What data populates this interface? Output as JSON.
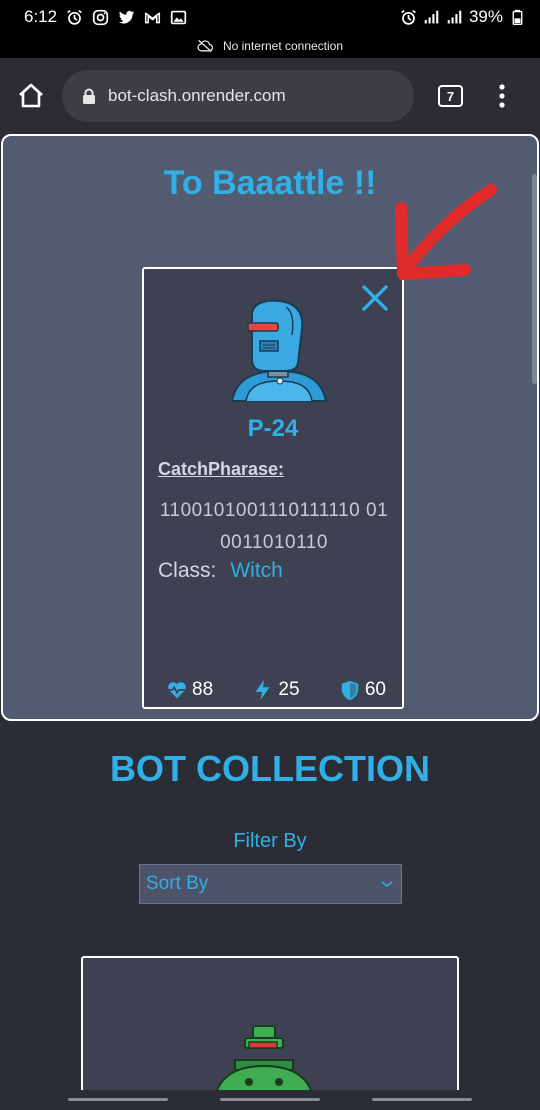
{
  "status_bar": {
    "time": "6:12",
    "battery": "39%",
    "left_icons": [
      "alarm-icon",
      "instagram-icon",
      "twitter-icon",
      "gmail-icon",
      "gallery-icon"
    ],
    "right_icons": [
      "alarm-icon",
      "signal-icon",
      "signal-icon",
      "battery-icon"
    ]
  },
  "offline_banner": "No internet connection",
  "browser": {
    "url": "bot-clash.onrender.com",
    "tab_count": "7"
  },
  "battle": {
    "title": "To Baaattle !!",
    "card": {
      "name": "P-24",
      "catchphrase_label": "CatchPharase:",
      "catchphrase_value": "1100101001110111110 010011010110",
      "class_label": "Class:",
      "class_value": "Witch",
      "health": "88",
      "damage": "25",
      "armor": "60"
    }
  },
  "collection": {
    "title": "BOT COLLECTION",
    "filter_label": "Filter By",
    "sort_placeholder": "Sort By"
  },
  "colors": {
    "accent": "#30b0e6",
    "panel": "#535b70",
    "card": "#3d4152",
    "background": "#2a2d36",
    "annotation_arrow": "#e12b2b"
  }
}
